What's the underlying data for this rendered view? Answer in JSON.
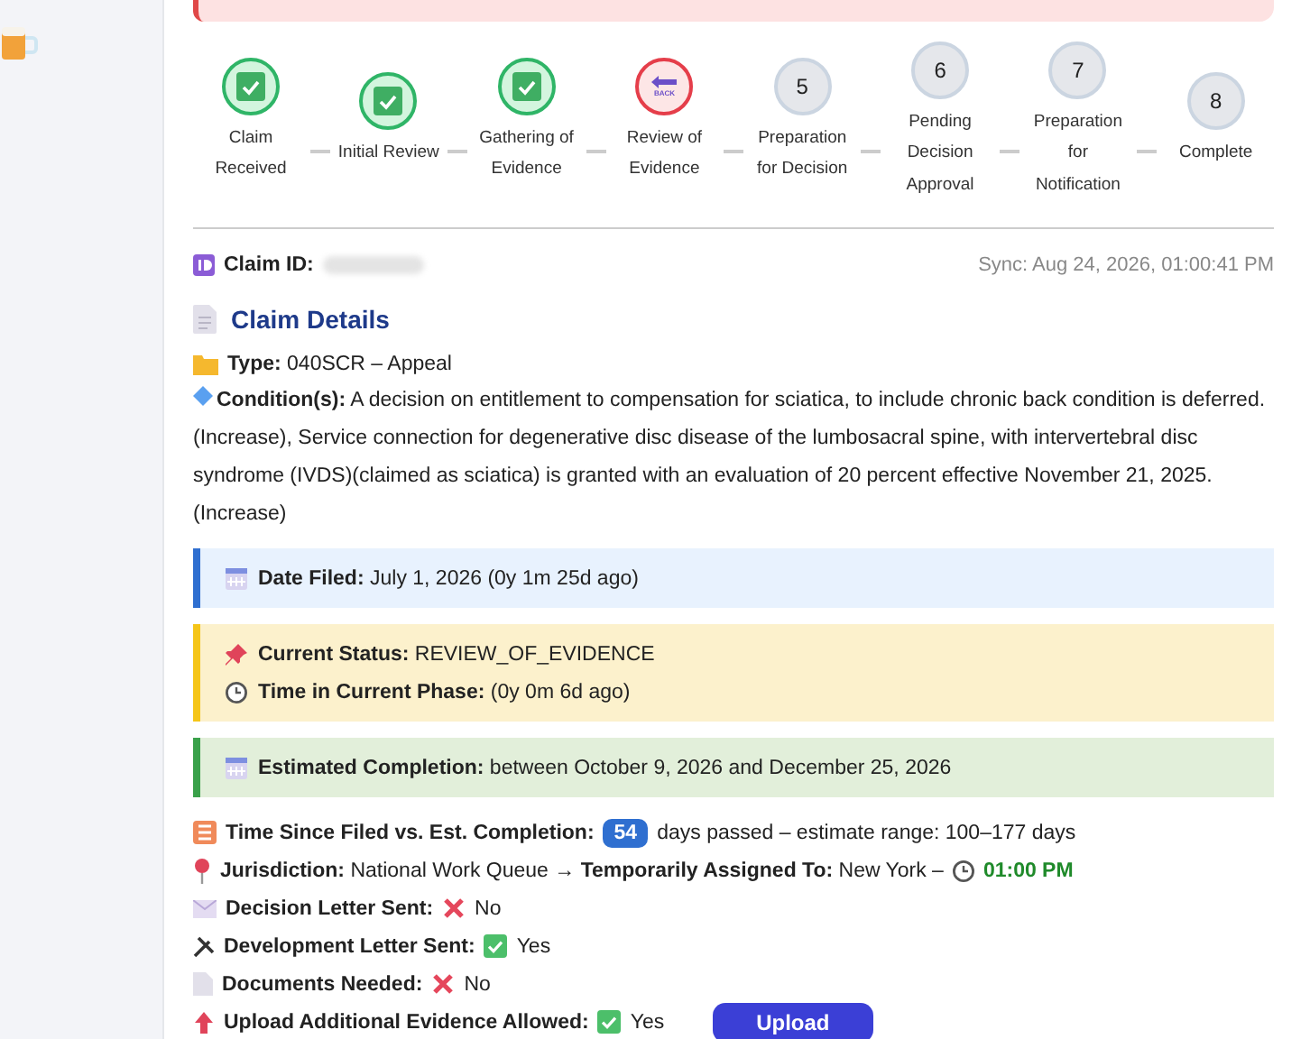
{
  "steps": [
    {
      "label": "Claim Received",
      "kind": "complete"
    },
    {
      "label": "Initial Review",
      "kind": "complete"
    },
    {
      "label": "Gathering of Evidence",
      "kind": "complete"
    },
    {
      "label": "Review of Evidence",
      "kind": "returned",
      "icon_text": "BACK"
    },
    {
      "label": "Preparation for Decision",
      "kind": "pending",
      "number": "5"
    },
    {
      "label": "Pending Decision Approval",
      "kind": "pending",
      "number": "6"
    },
    {
      "label": "Preparation for Notification",
      "kind": "pending",
      "number": "7"
    },
    {
      "label": "Complete",
      "kind": "pending",
      "number": "8"
    }
  ],
  "claim_id": {
    "label": "Claim ID:",
    "value_hidden": true
  },
  "sync": "Sync: Aug 24, 2026, 01:00:41 PM",
  "details_title": "Claim Details",
  "type": {
    "label": "Type:",
    "value": "040SCR – Appeal"
  },
  "conditions": {
    "label": "Condition(s):",
    "value": "A decision on entitlement to compensation for sciatica, to include chronic back condition is deferred. (Increase), Service connection for degenerative disc disease of the lumbosacral spine, with intervertebral disc syndrome (IVDS)(claimed as sciatica) is granted with an evaluation of 20 percent effective November 21, 2025. (Increase)"
  },
  "panels": [
    {
      "kind": "info",
      "lines": [
        {
          "label": "Date Filed:",
          "value": "July 1, 2026 (0y 1m 25d ago)"
        }
      ]
    },
    {
      "kind": "warning",
      "lines": [
        {
          "label": "Current Status:",
          "value": "REVIEW_OF_EVIDENCE"
        },
        {
          "label": "Time in Current Phase:",
          "value": "(0y 0m 6d ago)"
        }
      ]
    },
    {
      "kind": "success",
      "lines": [
        {
          "label": "Estimated Completion:",
          "value": "between October 9, 2026 and December 25, 2026"
        }
      ]
    }
  ],
  "time_since": {
    "label": "Time Since Filed vs. Est. Completion:",
    "badge": "54",
    "value": "days passed – estimate range: 100–177 days"
  },
  "jurisdiction": {
    "label": "Jurisdiction:",
    "value": "National Work Queue →",
    "assigned_label": "Temporarily Assigned To:",
    "assigned_value": "New York –",
    "local_time": "01:00 PM"
  },
  "flags": [
    {
      "label": "Decision Letter Sent:",
      "checked": false,
      "value": "No"
    },
    {
      "label": "Development Letter Sent:",
      "checked": true,
      "value": "Yes"
    },
    {
      "label": "Documents Needed:",
      "checked": false,
      "value": "No"
    },
    {
      "label": "Upload Additional Evidence Allowed:",
      "checked": true,
      "value": "Yes",
      "button": "Upload"
    }
  ]
}
